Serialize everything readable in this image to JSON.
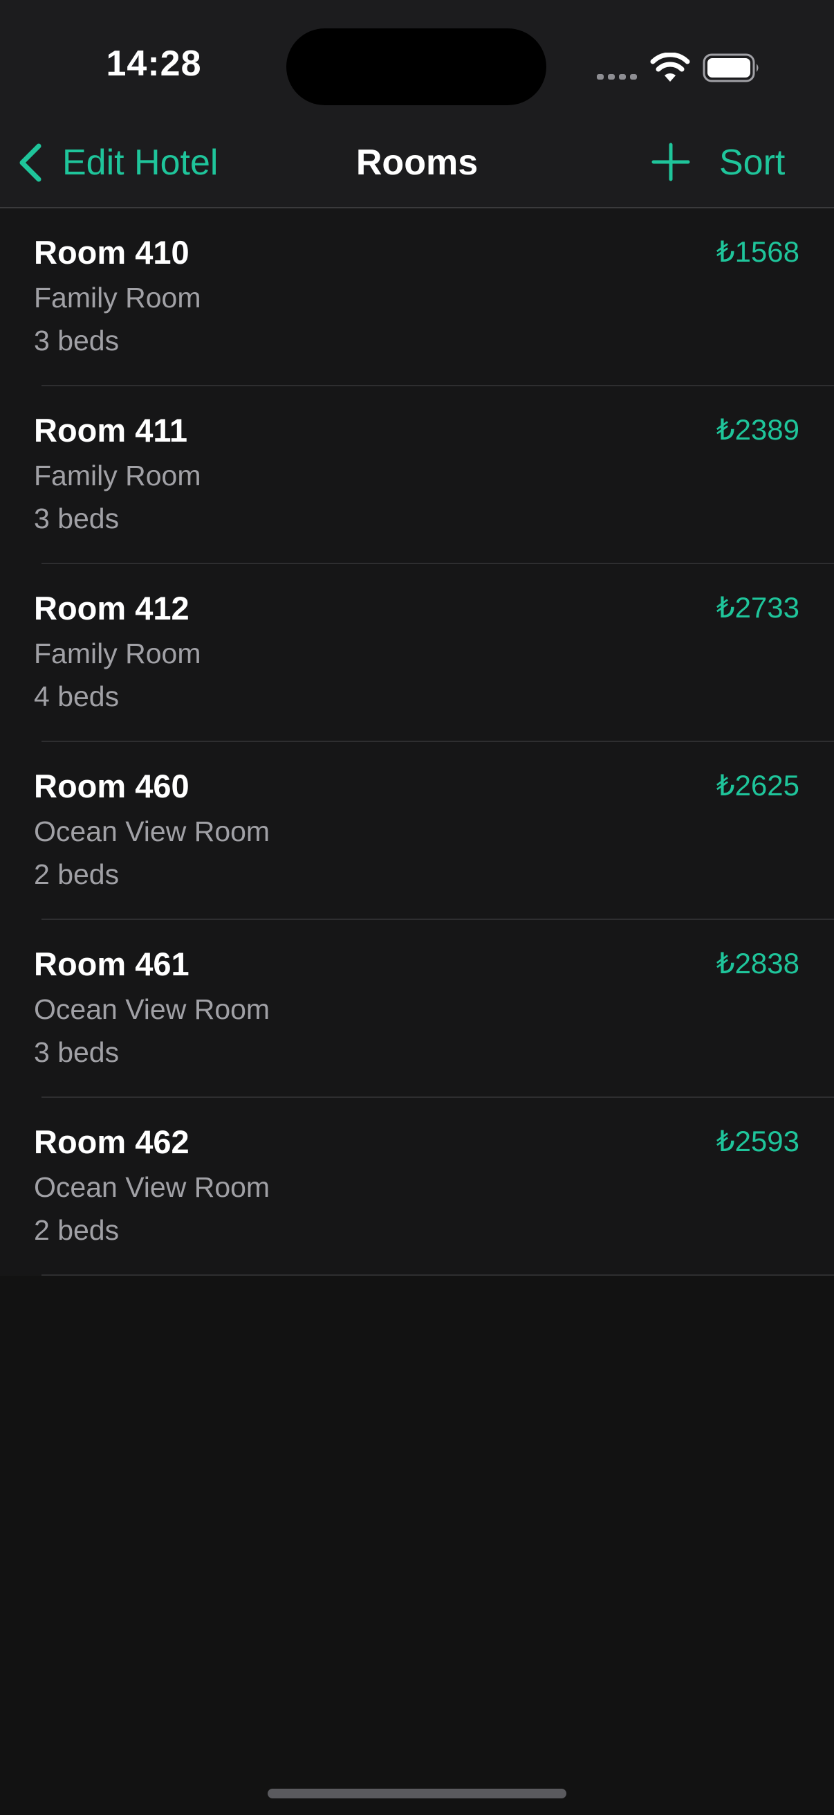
{
  "status_bar": {
    "time": "14:28"
  },
  "nav": {
    "back_label": "Edit Hotel",
    "title": "Rooms",
    "sort_label": "Sort"
  },
  "colors": {
    "accent": "#1fc59b",
    "background": "#121212",
    "secondary_text": "#a1a1a6"
  },
  "icons": [
    "chevron-left-icon",
    "plus-icon",
    "wifi-icon",
    "battery-icon",
    "signal-icon"
  ],
  "rooms": [
    {
      "name": "Room 410",
      "type": "Family Room",
      "beds": "3 beds",
      "price": "₺1568"
    },
    {
      "name": "Room 411",
      "type": "Family Room",
      "beds": "3 beds",
      "price": "₺2389"
    },
    {
      "name": "Room 412",
      "type": "Family Room",
      "beds": "4 beds",
      "price": "₺2733"
    },
    {
      "name": "Room 460",
      "type": "Ocean View Room",
      "beds": "2 beds",
      "price": "₺2625"
    },
    {
      "name": "Room 461",
      "type": "Ocean View Room",
      "beds": "3 beds",
      "price": "₺2838"
    },
    {
      "name": "Room 462",
      "type": "Ocean View Room",
      "beds": "2 beds",
      "price": "₺2593"
    }
  ]
}
